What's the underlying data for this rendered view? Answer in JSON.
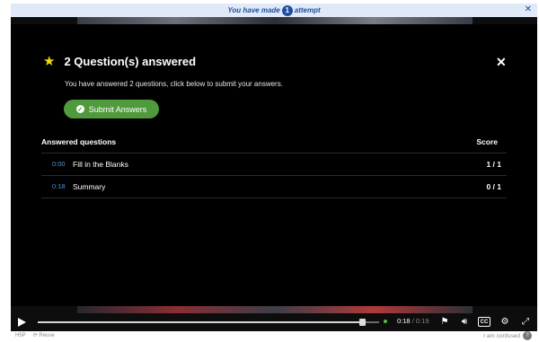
{
  "banner": {
    "prefix": "You have made",
    "count": "1",
    "suffix": "attempt",
    "close_icon": "close-icon"
  },
  "summary": {
    "title": "2 Question(s) answered",
    "description": "You have answered 2 questions, click below to submit your answers.",
    "submit_label": "Submit Answers",
    "table_header": {
      "left": "Answered questions",
      "right": "Score"
    },
    "rows": [
      {
        "time": "0:00",
        "name": "Fill in the Blanks",
        "score": "1 / 1"
      },
      {
        "time": "0:18",
        "name": "Summary",
        "score": "0 / 1"
      }
    ]
  },
  "controls": {
    "current_time": "0:18",
    "separator": "/",
    "duration": "0:19",
    "progress": 0.95
  },
  "footer": {
    "left_items": [
      "H5P",
      "Reuse"
    ],
    "right_label": "I am confused"
  },
  "colors": {
    "accent": "#1f4ea1",
    "submit": "#4f9a3c",
    "star": "#f5d90a",
    "time_link": "#4f8fd6"
  }
}
